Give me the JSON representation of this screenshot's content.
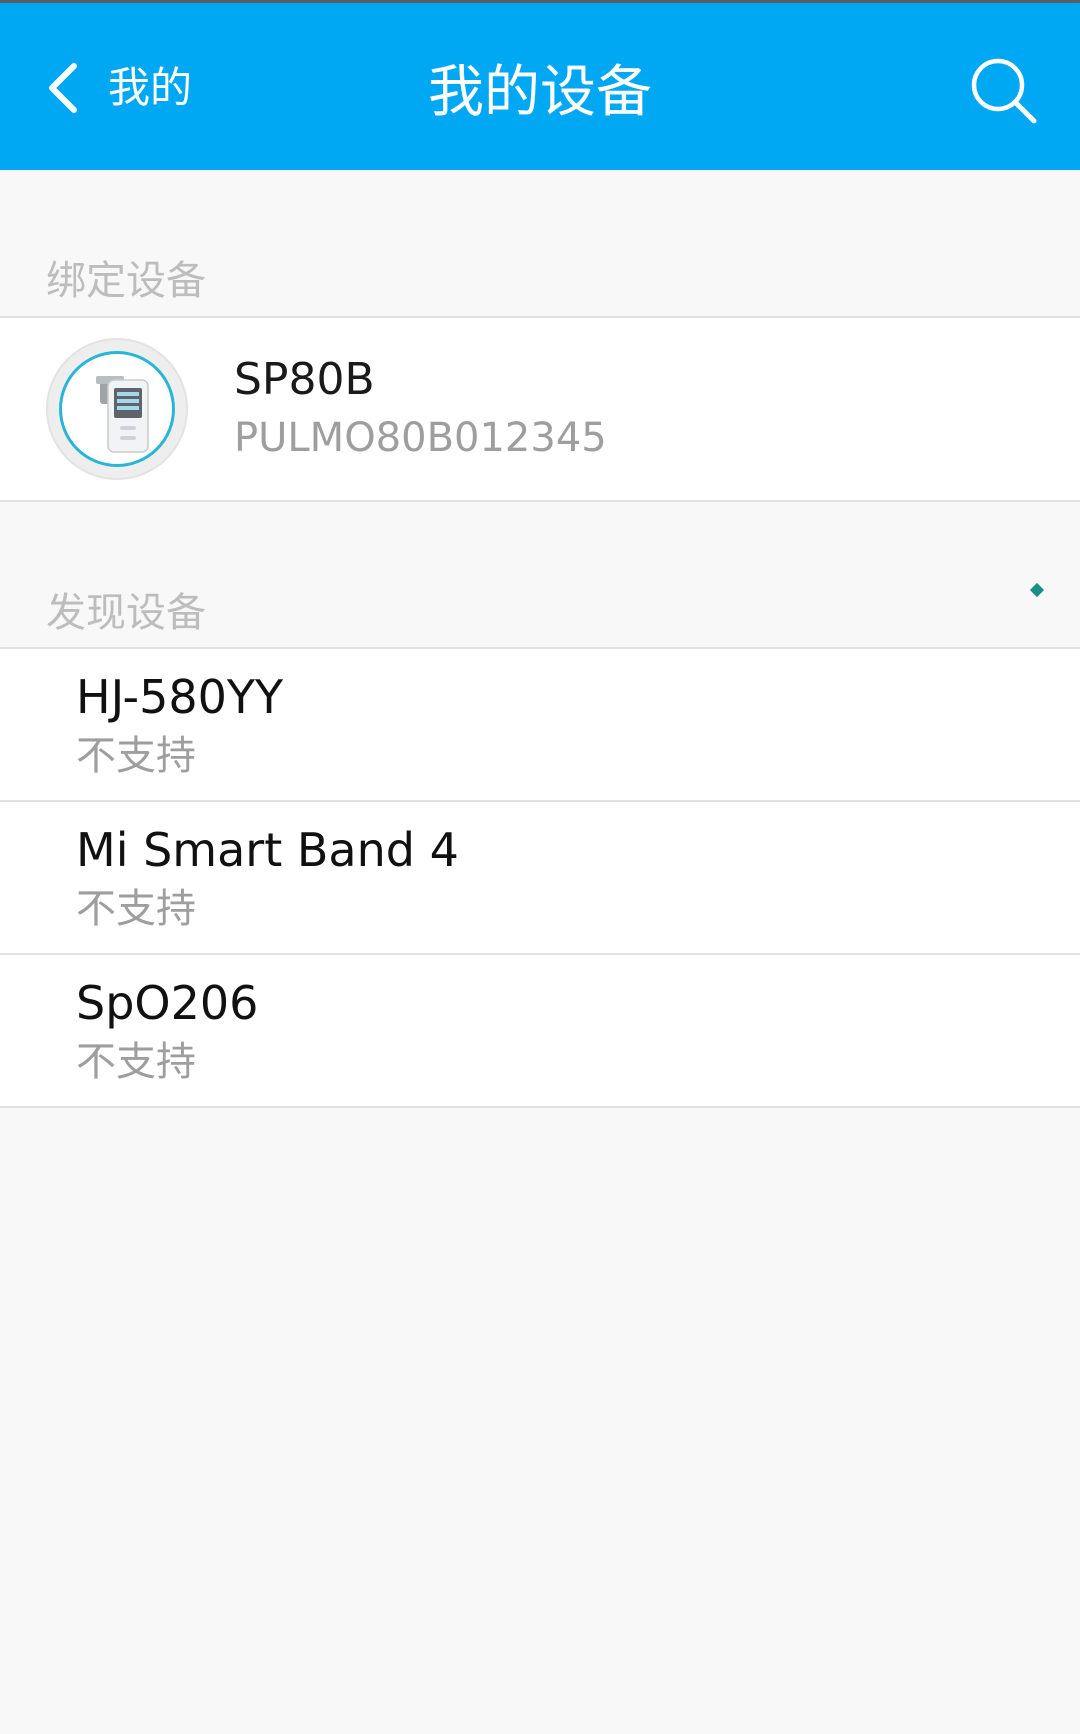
{
  "header": {
    "back_label": "我的",
    "title": "我的设备"
  },
  "bound_section": {
    "label": "绑定设备",
    "devices": [
      {
        "name": "SP80B",
        "id": "PULMO80B012345"
      }
    ]
  },
  "found_section": {
    "label": "发现设备",
    "devices": [
      {
        "name": "HJ-580YY",
        "status": "不支持"
      },
      {
        "name": "Mi Smart Band 4",
        "status": "不支持"
      },
      {
        "name": "SpO206",
        "status": "不支持"
      }
    ]
  },
  "colors": {
    "header_bg": "#00a8f3",
    "accent_ring": "#29b6d6",
    "page_bg": "#f8f8f8"
  }
}
